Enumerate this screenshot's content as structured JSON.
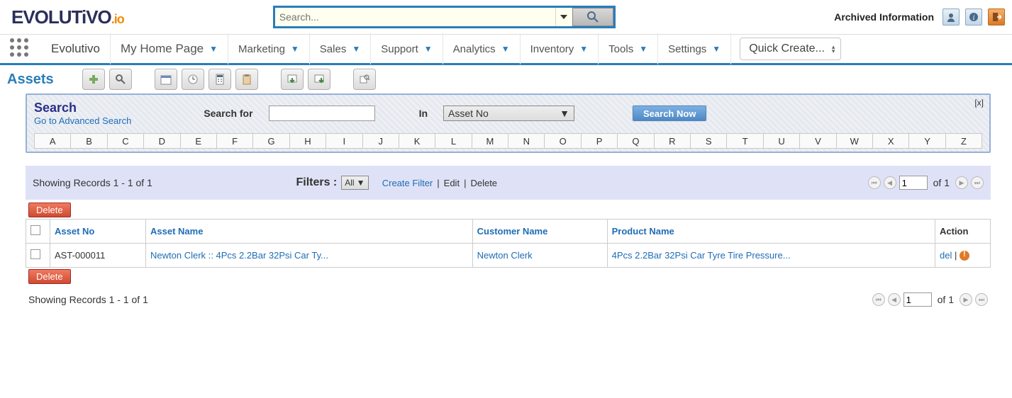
{
  "colors": {
    "primary": "#2a7db9",
    "accent": "#2a2f8a"
  },
  "brand": {
    "name": "EVOLUTiVO",
    "suffix": ".io"
  },
  "topsearch": {
    "placeholder": "Search..."
  },
  "topright": {
    "archived": "Archived Information"
  },
  "nav": {
    "brand": "Evolutivo",
    "myhome": "My Home Page",
    "items": [
      "Marketing",
      "Sales",
      "Support",
      "Analytics",
      "Inventory",
      "Tools",
      "Settings"
    ],
    "quickcreate": "Quick Create..."
  },
  "module": {
    "title": "Assets"
  },
  "search": {
    "title": "Search",
    "advanced": "Go to Advanced Search",
    "for_label": "Search for",
    "in_label": "In",
    "field": "Asset No",
    "button": "Search Now",
    "close": "[x]",
    "alpha": [
      "A",
      "B",
      "C",
      "D",
      "E",
      "F",
      "G",
      "H",
      "I",
      "J",
      "K",
      "L",
      "M",
      "N",
      "O",
      "P",
      "Q",
      "R",
      "S",
      "T",
      "U",
      "V",
      "W",
      "X",
      "Y",
      "Z"
    ]
  },
  "filterbar": {
    "records": "Showing Records 1 - 1 of 1",
    "filters_label": "Filters :",
    "view": "All",
    "create": "Create Filter",
    "edit": "Edit",
    "del": "Delete",
    "page": "1",
    "of_total": "of 1"
  },
  "table": {
    "delete_button": "Delete",
    "headers": {
      "assetno": "Asset No",
      "assetname": "Asset Name",
      "customer": "Customer Name",
      "product": "Product Name",
      "action": "Action"
    },
    "rows": [
      {
        "assetno": "AST-000011",
        "assetname": "Newton Clerk :: 4Pcs 2.2Bar 32Psi Car Ty...",
        "customer": "Newton Clerk",
        "product": "4Pcs 2.2Bar 32Psi Car Tyre Tire Pressure...",
        "del": "del"
      }
    ]
  },
  "bottom": {
    "records": "Showing Records 1 - 1 of 1",
    "page": "1",
    "of_total": "of 1"
  }
}
